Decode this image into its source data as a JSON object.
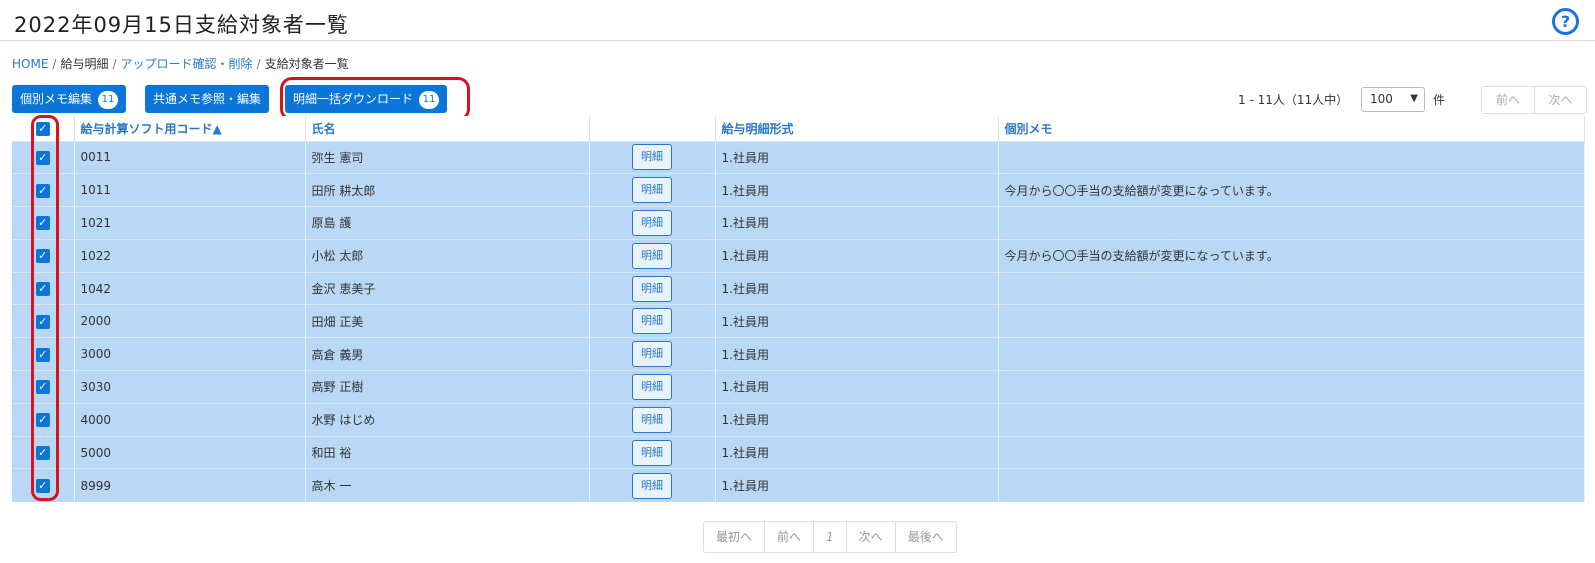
{
  "header": {
    "title": "2022年09月15日支給対象者一覧",
    "help_icon": "question-circle-icon"
  },
  "breadcrumb": {
    "home": "HOME",
    "payroll": "給与明細",
    "upload": "アップロード確認・削除",
    "current": "支給対象者一覧",
    "separator": "/"
  },
  "toolbar": {
    "memo_edit_label": "個別メモ編集",
    "memo_edit_count": "11",
    "common_memo_label": "共通メモ参照・編集",
    "bulk_download_label": "明細一括ダウンロード",
    "bulk_download_count": "11"
  },
  "pagination_top": {
    "count_text": "1 - 11人（11人中）",
    "per_page": "100",
    "unit": "件",
    "prev": "前へ",
    "next": "次へ"
  },
  "table": {
    "headers": {
      "code": "給与計算ソフト用コード▲",
      "name": "氏名",
      "detail": "",
      "format": "給与明細形式",
      "memo": "個別メモ"
    },
    "detail_button_label": "明細",
    "rows": [
      {
        "code": "0011",
        "name": "弥生 憲司",
        "format": "1.社員用",
        "memo": ""
      },
      {
        "code": "1011",
        "name": "田所 耕太郎",
        "format": "1.社員用",
        "memo": "今月から〇〇手当の支給額が変更になっています。"
      },
      {
        "code": "1021",
        "name": "原島 護",
        "format": "1.社員用",
        "memo": ""
      },
      {
        "code": "1022",
        "name": "小松 太郎",
        "format": "1.社員用",
        "memo": "今月から〇〇手当の支給額が変更になっています。"
      },
      {
        "code": "1042",
        "name": "金沢 恵美子",
        "format": "1.社員用",
        "memo": ""
      },
      {
        "code": "2000",
        "name": "田畑 正美",
        "format": "1.社員用",
        "memo": ""
      },
      {
        "code": "3000",
        "name": "高倉 義男",
        "format": "1.社員用",
        "memo": ""
      },
      {
        "code": "3030",
        "name": "高野 正樹",
        "format": "1.社員用",
        "memo": ""
      },
      {
        "code": "4000",
        "name": "水野 はじめ",
        "format": "1.社員用",
        "memo": ""
      },
      {
        "code": "5000",
        "name": "和田 裕",
        "format": "1.社員用",
        "memo": ""
      },
      {
        "code": "8999",
        "name": "高木 一",
        "format": "1.社員用",
        "memo": ""
      }
    ]
  },
  "pagination_bottom": {
    "first": "最初へ",
    "prev": "前へ",
    "page": "1",
    "next": "次へ",
    "last": "最後へ"
  },
  "colors": {
    "accent": "#0b75d8",
    "row_selected": "#b8d8f5",
    "highlight": "#d7141e"
  }
}
